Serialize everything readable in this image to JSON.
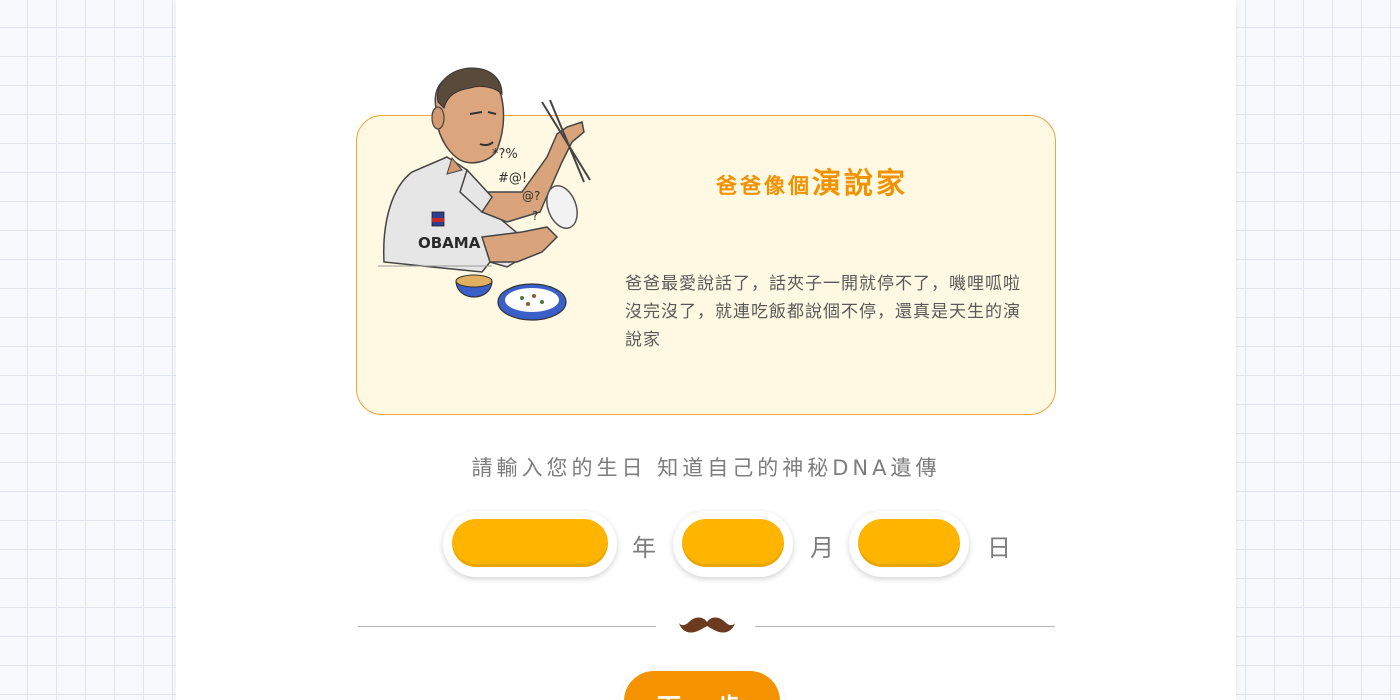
{
  "card": {
    "title_prefix": "爸爸像個",
    "title_emphasis": "演說家",
    "description": "爸爸最愛說話了，話夾子一開就停不了，嘰哩呱啦沒完沒了，就連吃飯都說個不停，還真是天生的演說家",
    "shirt_text": "OBAMA"
  },
  "birthday": {
    "prompt": "請輸入您的生日 知道自己的神秘DNA遺傳",
    "year_unit": "年",
    "month_unit": "月",
    "day_unit": "日"
  },
  "actions": {
    "next_label": "下一步"
  },
  "colors": {
    "accent": "#f29200",
    "input_fill": "#ffb400",
    "card_bg": "#fff9e3",
    "card_border": "#f3a33a",
    "mustache": "#6b3a1f"
  },
  "icons": {
    "divider_ornament": "mustache-icon"
  }
}
